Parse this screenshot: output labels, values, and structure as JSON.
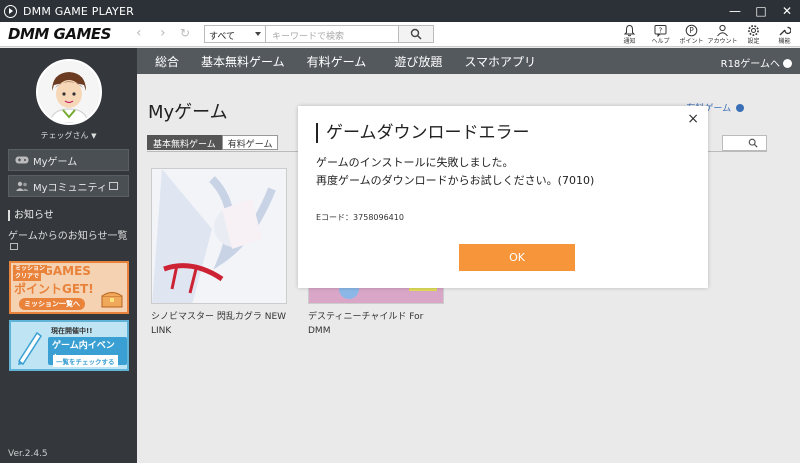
{
  "window": {
    "title": "DMM GAME PLAYER",
    "controls": [
      "—",
      "□",
      "✕"
    ]
  },
  "toolbar": {
    "logo": "DMM GAMES",
    "search_category": "すべて",
    "search_placeholder": "キーワードで検索",
    "icons": [
      {
        "name": "notification-icon",
        "label": "通知"
      },
      {
        "name": "help-icon",
        "label": "ヘルプ"
      },
      {
        "name": "points-icon",
        "label": "ポイント"
      },
      {
        "name": "account-icon",
        "label": "アカウント"
      },
      {
        "name": "settings-icon",
        "label": "設定"
      },
      {
        "name": "tools-icon",
        "label": "機能"
      }
    ]
  },
  "sidebar": {
    "user_name": "テェッグさん",
    "items": [
      {
        "label": "Myゲーム"
      },
      {
        "label": "Myコミュニティ"
      }
    ],
    "notice_title": "お知らせ",
    "notice_link": "ゲームからのお知らせ一覧",
    "banner1": {
      "line1": "ミッション",
      "line2": "クリアで",
      "main": "GAMES",
      "main2": "ポイントGET!",
      "sub": "ミッション一覧へ"
    },
    "banner2": {
      "line1": "現在開催中!!",
      "main": "ゲーム内イベント",
      "sub": "一覧をチェックする"
    },
    "version": "Ver.2.4.5"
  },
  "menu": {
    "items": [
      "総合",
      "基本無料ゲーム",
      "有料ゲーム",
      "遊び放題",
      "スマホアプリ"
    ],
    "r18": "R18ゲームへ"
  },
  "main": {
    "heading": "Myゲーム",
    "all_games_link": "有料ゲーム",
    "tabs": [
      "基本無料ゲーム",
      "有料ゲーム"
    ],
    "games": [
      {
        "title": "シノビマスター 閃乱カグラ NEW LINK"
      },
      {
        "title": "デスティニーチャイルド For DMM"
      }
    ]
  },
  "dialog": {
    "title": "ゲームダウンロードエラー",
    "message_line1": "ゲームのインストールに失敗しました。",
    "message_line2": "再度ゲームのダウンロードからお試しください。(7010)",
    "error_code": "Eコード：3758096410",
    "ok_label": "OK",
    "close_label": "×"
  },
  "colors": {
    "accent_orange": "#f7953a",
    "sidebar_bg": "#34383c",
    "menubar_bg": "#54595e",
    "titlebar_bg": "#2b3136"
  }
}
